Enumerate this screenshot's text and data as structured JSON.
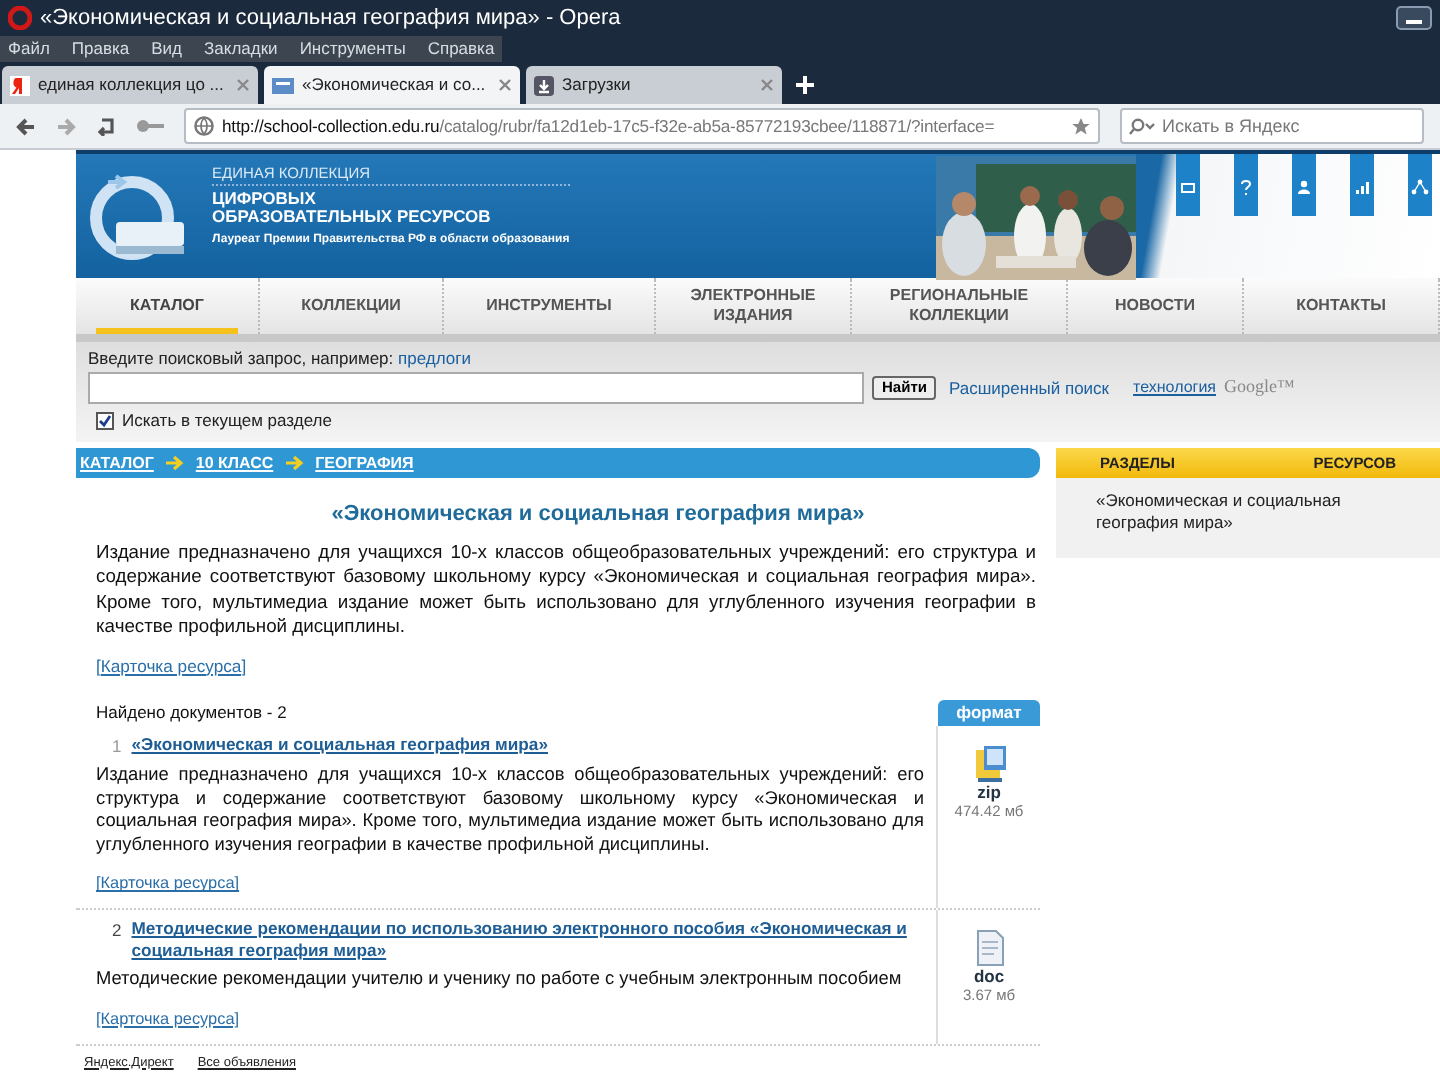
{
  "window": {
    "title": "«Экономическая и социальная география мира» - Opera"
  },
  "menu": [
    "Файл",
    "Правка",
    "Вид",
    "Закладки",
    "Инструменты",
    "Справка"
  ],
  "tabs": [
    {
      "label": "единая коллекция цо ...",
      "selected": false,
      "kind": "yandex"
    },
    {
      "label": "«Экономическая и со...",
      "selected": true,
      "kind": "page"
    },
    {
      "label": "Загрузки",
      "selected": false,
      "kind": "downloads"
    }
  ],
  "address": {
    "url_host": "http://school-collection.edu.ru",
    "url_path": "/catalog/rubr/fa12d1eb-17c5-f32e-ab5a-85772193cbee/118871/?interface=",
    "search_placeholder": "Искать в Яндекс"
  },
  "header": {
    "line1": "ЕДИНАЯ КОЛЛЕКЦИЯ",
    "line2": "ЦИФРОВЫХ",
    "line3": "ОБРАЗОВАТЕЛЬНЫХ РЕСУРСОВ",
    "tagline": "Лауреат Премии Правительства РФ в области образования"
  },
  "nav": [
    {
      "label": "КАТАЛОГ",
      "selected": true
    },
    {
      "label": "КОЛЛЕКЦИИ",
      "selected": false
    },
    {
      "label": "ИНСТРУМЕНТЫ",
      "selected": false
    },
    {
      "label": "ЭЛЕКТРОННЫЕ ИЗДАНИЯ",
      "selected": false
    },
    {
      "label": "РЕГИОНАЛЬНЫЕ КОЛЛЕКЦИИ",
      "selected": false
    },
    {
      "label": "НОВОСТИ",
      "selected": false
    },
    {
      "label": "КОНТАКТЫ",
      "selected": false
    }
  ],
  "search": {
    "hint": "Введите поисковый запрос, например:",
    "example": "предлоги",
    "button": "Найти",
    "advanced": "Расширенный поиск",
    "tech": "технология",
    "google": "Google™",
    "scope_label": "Искать в текущем разделе",
    "scope_checked": true
  },
  "breadcrumbs": [
    "КАТАЛОГ",
    "10 КЛАСС",
    "ГЕОГРАФИЯ"
  ],
  "sidebar": {
    "heading_1": "РАЗДЕЛЫ",
    "heading_2": "РЕСУРСОВ",
    "items": [
      "«Экономическая и социальная география мира»"
    ]
  },
  "main": {
    "title": "«Экономическая и социальная география мира»",
    "description": "Издание предназначено для учащихся 10-х классов общеобразовательных учреждений: его структура и содержание соответствуют базовому школьному курсу «Экономическая и социальная география мира». Кроме того, мультимедиа издание может быть использовано для углубленного изучения географии в качестве профильной дисциплины.",
    "card_link": "[Карточка ресурса]",
    "found": "Найдено документов - 2",
    "format_heading": "формат"
  },
  "results": [
    {
      "number": "1",
      "title": "«Экономическая и социальная география мира»",
      "description": "Издание предназначено для учащихся 10-х классов общеобразовательных учреждений: его структура и содержание соответствуют базовому школьному курсу «Экономическая и социальная география мира». Кроме того, мультимедиа издание может быть использовано для углубленного изучения географии в качестве профильной дисциплины.",
      "card_link": "[Карточка ресурса]",
      "format": "zip",
      "kind": "zip",
      "size": "474.42 мб"
    },
    {
      "number": "2",
      "title": "Методические рекомендации по использованию электронного пособия «Экономическая и социальная география мира»",
      "description": "Методические рекомендации учителю и ученику по работе с учебным электронным пособием",
      "card_link": "[Карточка ресурса]",
      "format": "doc",
      "kind": "doc",
      "size": "3.67 мб"
    }
  ],
  "footer": [
    "Яндекс.Директ",
    "Все объявления"
  ]
}
